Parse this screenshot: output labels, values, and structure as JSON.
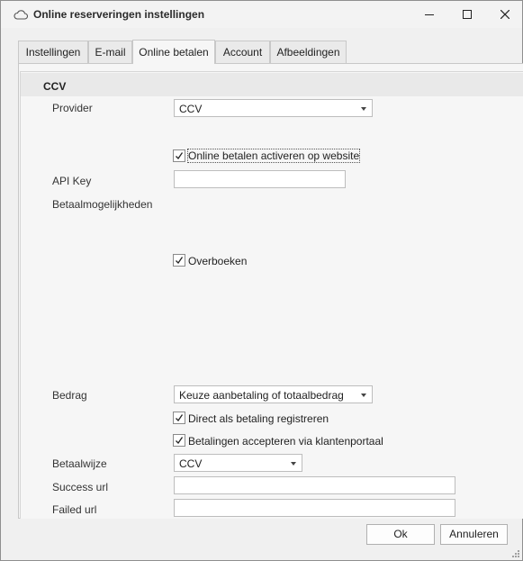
{
  "window": {
    "title": "Online reserveringen instellingen",
    "icon": "cloud-icon"
  },
  "tabs": [
    {
      "label": "Instellingen",
      "active": false
    },
    {
      "label": "E-mail",
      "active": false
    },
    {
      "label": "Online betalen",
      "active": true
    },
    {
      "label": "Account",
      "active": false
    },
    {
      "label": "Afbeeldingen",
      "active": false
    }
  ],
  "group": {
    "title": "CCV"
  },
  "form": {
    "provider_label": "Provider",
    "provider_value": "CCV",
    "online_activate_label": "Online betalen activeren op website",
    "online_activate_checked": true,
    "api_key_label": "API Key",
    "api_key_value": "",
    "betaalmogelijkheden_label": "Betaalmogelijkheden",
    "overboeken_label": "Overboeken",
    "overboeken_checked": true,
    "bedrag_label": "Bedrag",
    "bedrag_value": "Keuze aanbetaling of totaalbedrag",
    "direct_label": "Direct als betaling registreren",
    "direct_checked": true,
    "klantenportaal_label": "Betalingen accepteren via klantenportaal",
    "klantenportaal_checked": true,
    "betaalwijze_label": "Betaalwijze",
    "betaalwijze_value": "CCV",
    "success_url_label": "Success url",
    "success_url_value": "",
    "failed_url_label": "Failed url",
    "failed_url_value": ""
  },
  "buttons": {
    "ok": "Ok",
    "cancel": "Annuleren"
  }
}
